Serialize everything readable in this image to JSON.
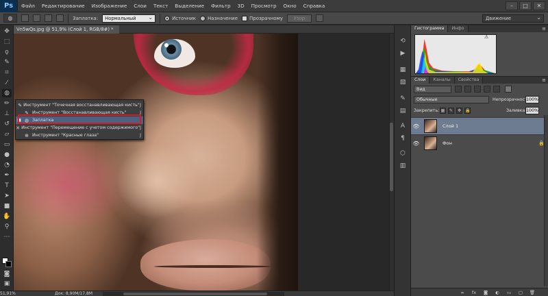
{
  "app": {
    "logo": "Ps"
  },
  "menu": [
    "Файл",
    "Редактирование",
    "Изображение",
    "Слои",
    "Текст",
    "Выделение",
    "Фильтр",
    "3D",
    "Просмотр",
    "Окно",
    "Справка"
  ],
  "window_controls": [
    "–",
    "□",
    "✕"
  ],
  "options": {
    "patch_label": "Заплатка:",
    "patch_mode": "Нормальный",
    "source_label": "Источник",
    "dest_label": "Назначение",
    "transparent_label": "Прозрачному",
    "pattern_label": "Узор",
    "workspace": "Движение"
  },
  "document": {
    "tab_title": "Vn5wQs.jpg @ 51,9% (Слой 1, RGB/8#) *"
  },
  "flyout": {
    "items": [
      {
        "label": "Инструмент \"Точечная восстанавливающая кисть\"",
        "key": "J",
        "icon": "spot-healing-icon",
        "glyph": "✎"
      },
      {
        "label": "Инструмент \"Восстанавливающая кисть\"",
        "key": "J",
        "icon": "healing-brush-icon",
        "glyph": "✎"
      },
      {
        "label": "Заплатка",
        "key": "J",
        "icon": "patch-icon",
        "glyph": "◍",
        "selected": true,
        "bullet": "■"
      },
      {
        "label": "Инструмент \"Перемещение с учетом содержимого\"",
        "key": "J",
        "icon": "content-aware-move-icon",
        "glyph": "✕"
      },
      {
        "label": "Инструмент \"Красные глаза\"",
        "key": "J",
        "icon": "red-eye-icon",
        "glyph": "⊕"
      }
    ]
  },
  "status": {
    "zoom": "51,91%",
    "doc_size": "Док: 8,90M/17,8M"
  },
  "histogram": {
    "tabs": [
      "Гистограмма",
      "Инфо"
    ],
    "warning_glyph": "⚠",
    "colors": {
      "red": "#ff2020",
      "green": "#00c000",
      "blue": "#2040ff",
      "yellow": "#ffee00",
      "cyan": "#00c8ff",
      "magenta": "#ff00ff"
    }
  },
  "layers": {
    "tabs": [
      "Слои",
      "Каналы",
      "Свойства"
    ],
    "filter_kind": "Вид",
    "blend_mode": "Обычные",
    "opacity_label": "Непрозрачность:",
    "opacity": "100%",
    "lock_label": "Закрепить:",
    "fill_label": "Заливка:",
    "fill": "100%",
    "items": [
      {
        "name": "Слой 1",
        "selected": true,
        "locked": false
      },
      {
        "name": "Фон",
        "selected": false,
        "locked": true
      }
    ],
    "footer_icons": [
      "link-icon",
      "fx-icon",
      "mask-icon",
      "adjustment-icon",
      "folder-icon",
      "new-layer-icon",
      "trash-icon"
    ]
  }
}
